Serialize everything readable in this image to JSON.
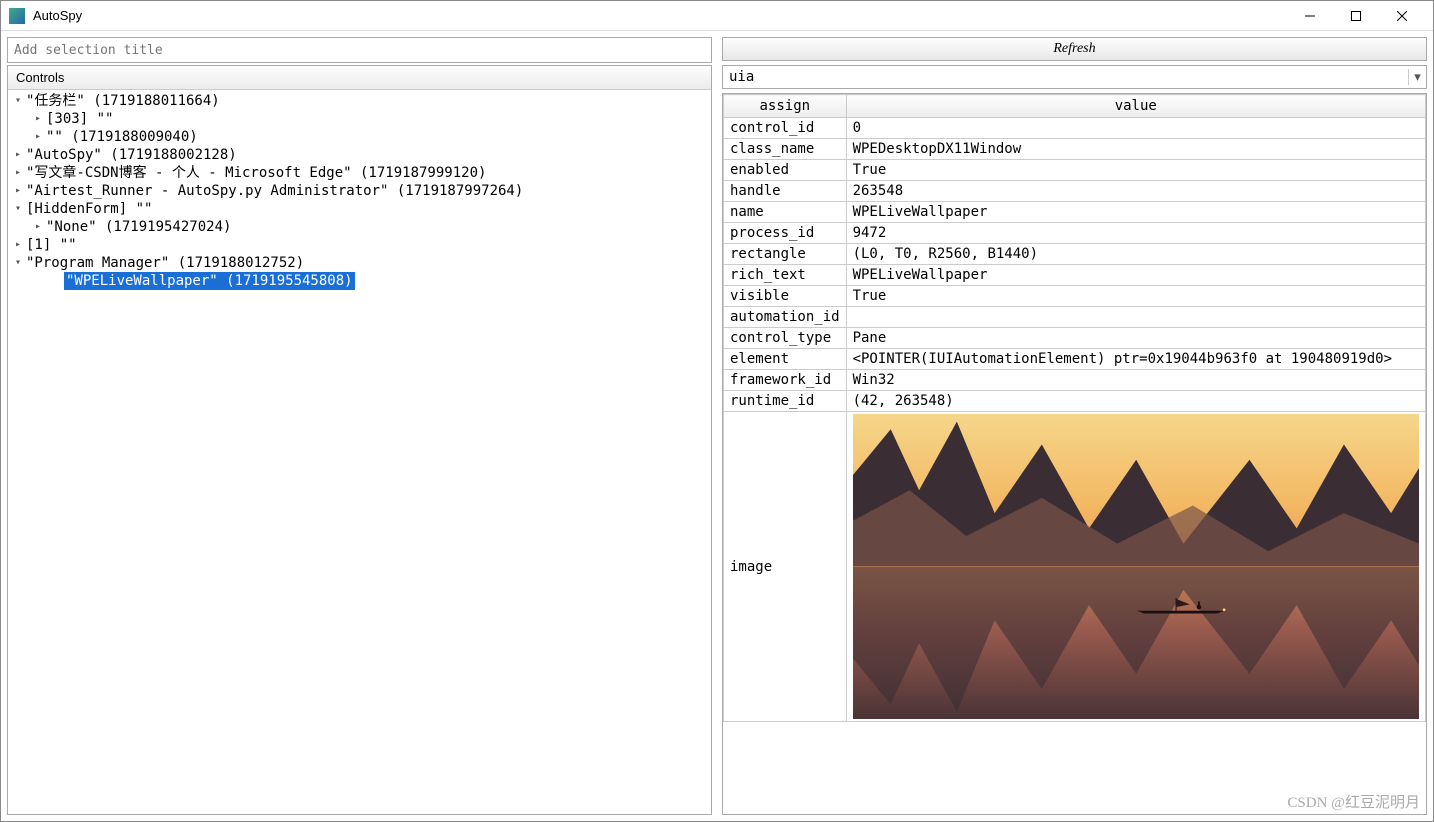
{
  "window": {
    "title": "AutoSpy"
  },
  "left": {
    "placeholder": "Add selection title",
    "tree_header": "Controls",
    "tree": [
      {
        "indent": 0,
        "toggle": "▾",
        "text": "\"任务栏\" (1719188011664)"
      },
      {
        "indent": 1,
        "toggle": "▸",
        "text": "[303] \"\""
      },
      {
        "indent": 1,
        "toggle": "▸",
        "text": "\"\" (1719188009040)"
      },
      {
        "indent": 0,
        "toggle": "▸",
        "text": "\"AutoSpy\" (1719188002128)"
      },
      {
        "indent": 0,
        "toggle": "▸",
        "text": "\"写文章-CSDN博客 - 个人 - Microsoft Edge\" (1719187999120)"
      },
      {
        "indent": 0,
        "toggle": "▸",
        "text": "\"Airtest_Runner - AutoSpy.py Administrator\" (1719187997264)"
      },
      {
        "indent": 0,
        "toggle": "▾",
        "text": "[HiddenForm] \"\""
      },
      {
        "indent": 1,
        "toggle": "▸",
        "text": "\"None\" (1719195427024)"
      },
      {
        "indent": 0,
        "toggle": "▸",
        "text": "[1] \"\""
      },
      {
        "indent": 0,
        "toggle": "▾",
        "text": "\"Program Manager\" (1719188012752)"
      },
      {
        "indent": 2,
        "toggle": "",
        "text": "\"WPELiveWallpaper\" (1719195545808)",
        "selected": true
      }
    ]
  },
  "right": {
    "refresh_label": "Refresh",
    "select_value": "uia",
    "headers": {
      "key": "assign",
      "value": "value"
    },
    "rows": [
      {
        "k": "control_id",
        "v": "0"
      },
      {
        "k": "class_name",
        "v": "WPEDesktopDX11Window"
      },
      {
        "k": "enabled",
        "v": "True"
      },
      {
        "k": "handle",
        "v": "263548"
      },
      {
        "k": "name",
        "v": "WPELiveWallpaper"
      },
      {
        "k": "process_id",
        "v": "9472"
      },
      {
        "k": "rectangle",
        "v": "(L0, T0, R2560, B1440)"
      },
      {
        "k": "rich_text",
        "v": "WPELiveWallpaper"
      },
      {
        "k": "visible",
        "v": "True"
      },
      {
        "k": "automation_id",
        "v": ""
      },
      {
        "k": "control_type",
        "v": "Pane"
      },
      {
        "k": "element",
        "v": "<POINTER(IUIAutomationElement) ptr=0x19044b963f0 at 190480919d0>"
      },
      {
        "k": "framework_id",
        "v": "Win32"
      },
      {
        "k": "runtime_id",
        "v": "(42, 263548)"
      }
    ],
    "image_label": "image"
  },
  "watermark": "CSDN @红豆泥明月"
}
